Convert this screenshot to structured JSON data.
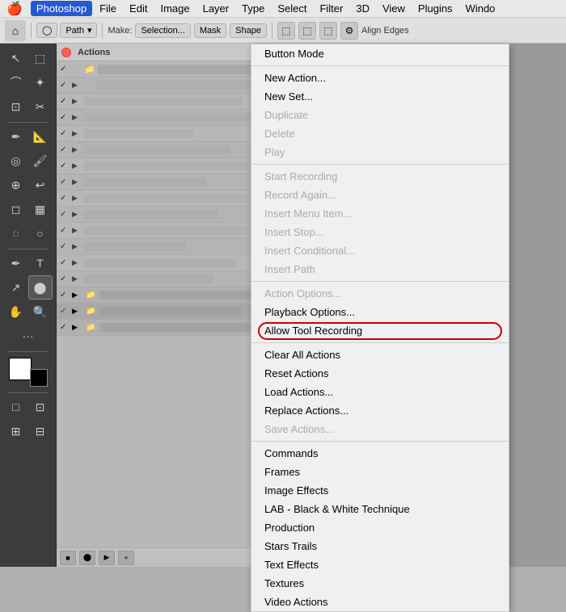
{
  "menubar": {
    "apple": "🍎",
    "items": [
      {
        "label": "Photoshop",
        "active": true
      },
      {
        "label": "File",
        "active": false
      },
      {
        "label": "Edit",
        "active": false
      },
      {
        "label": "Image",
        "active": false
      },
      {
        "label": "Layer",
        "active": false
      },
      {
        "label": "Type",
        "active": false
      },
      {
        "label": "Select",
        "active": false
      },
      {
        "label": "Filter",
        "active": false
      },
      {
        "label": "3D",
        "active": false
      },
      {
        "label": "View",
        "active": false
      },
      {
        "label": "Plugins",
        "active": false
      },
      {
        "label": "Windo",
        "active": false
      }
    ]
  },
  "toolbar": {
    "home_icon": "⌂",
    "shape_label": "Path",
    "make_label": "Make:",
    "selection_label": "Selection...",
    "mask_label": "Mask",
    "shape_btn_label": "Shape",
    "align_edges_label": "Align Edges",
    "settings_icon": "⚙"
  },
  "panel": {
    "title": "Actions",
    "close_icon": "×",
    "menu_icon": "≡"
  },
  "dropdown": {
    "items": [
      {
        "label": "Button Mode",
        "type": "normal"
      },
      {
        "label": "",
        "type": "sep"
      },
      {
        "label": "New Action...",
        "type": "normal"
      },
      {
        "label": "New Set...",
        "type": "normal"
      },
      {
        "label": "Duplicate",
        "type": "disabled"
      },
      {
        "label": "Delete",
        "type": "disabled"
      },
      {
        "label": "Play",
        "type": "disabled"
      },
      {
        "label": "",
        "type": "sep"
      },
      {
        "label": "Start Recording",
        "type": "disabled"
      },
      {
        "label": "Record Again...",
        "type": "disabled"
      },
      {
        "label": "Insert Menu Item...",
        "type": "disabled"
      },
      {
        "label": "Insert Stop...",
        "type": "disabled"
      },
      {
        "label": "Insert Conditional...",
        "type": "disabled"
      },
      {
        "label": "Insert Path",
        "type": "disabled"
      },
      {
        "label": "",
        "type": "sep"
      },
      {
        "label": "Action Options...",
        "type": "disabled"
      },
      {
        "label": "Playback Options...",
        "type": "normal"
      },
      {
        "label": "Allow Tool Recording",
        "type": "circled"
      },
      {
        "label": "",
        "type": "sep"
      },
      {
        "label": "Clear All Actions",
        "type": "normal"
      },
      {
        "label": "Reset Actions",
        "type": "normal"
      },
      {
        "label": "Load Actions...",
        "type": "normal"
      },
      {
        "label": "Replace Actions...",
        "type": "normal"
      },
      {
        "label": "Save Actions...",
        "type": "disabled"
      },
      {
        "label": "",
        "type": "sep"
      },
      {
        "label": "Commands",
        "type": "normal"
      },
      {
        "label": "Frames",
        "type": "normal"
      },
      {
        "label": "Image Effects",
        "type": "normal"
      },
      {
        "label": "LAB - Black & White Technique",
        "type": "normal"
      },
      {
        "label": "Production",
        "type": "normal"
      },
      {
        "label": "Stars Trails",
        "type": "normal"
      },
      {
        "label": "Text Effects",
        "type": "normal"
      },
      {
        "label": "Textures",
        "type": "normal"
      },
      {
        "label": "Video Actions",
        "type": "normal"
      }
    ]
  },
  "actions_rows": [
    {
      "check": "✓",
      "expand": "▶",
      "folder": true,
      "bar_width": "70%"
    },
    {
      "check": "✓",
      "expand": "▶",
      "folder": false,
      "bar_width": "55%"
    },
    {
      "check": "✓",
      "expand": "▶",
      "folder": false,
      "bar_width": "80%"
    },
    {
      "check": "✓",
      "expand": "▶",
      "folder": false,
      "bar_width": "45%"
    },
    {
      "check": "✓",
      "expand": "▶",
      "folder": false,
      "bar_width": "65%"
    },
    {
      "check": "✓",
      "expand": "▶",
      "folder": false,
      "bar_width": "50%"
    },
    {
      "check": "✓",
      "expand": "▶",
      "folder": false,
      "bar_width": "75%"
    },
    {
      "check": "✓",
      "expand": "▶",
      "folder": false,
      "bar_width": "40%"
    },
    {
      "check": "✓",
      "expand": "▶",
      "folder": false,
      "bar_width": "60%"
    },
    {
      "check": "✓",
      "expand": "▶",
      "folder": false,
      "bar_width": "55%"
    },
    {
      "check": "✓",
      "expand": "▶",
      "folder": false,
      "bar_width": "70%"
    },
    {
      "check": "✓",
      "expand": "▶",
      "folder": false,
      "bar_width": "48%"
    },
    {
      "check": "✓",
      "expand": "▶",
      "folder": false,
      "bar_width": "62%"
    },
    {
      "check": "✓",
      "expand": "▶",
      "folder": false,
      "bar_width": "53%"
    },
    {
      "check": "✓",
      "expand": "▶",
      "folder": true,
      "bar_width": "68%"
    },
    {
      "check": "✓",
      "expand": "▶",
      "folder": true,
      "red": true,
      "bar_width": "58%"
    },
    {
      "check": "✓",
      "expand": "▶",
      "folder": true,
      "bar_width": "72%"
    }
  ]
}
